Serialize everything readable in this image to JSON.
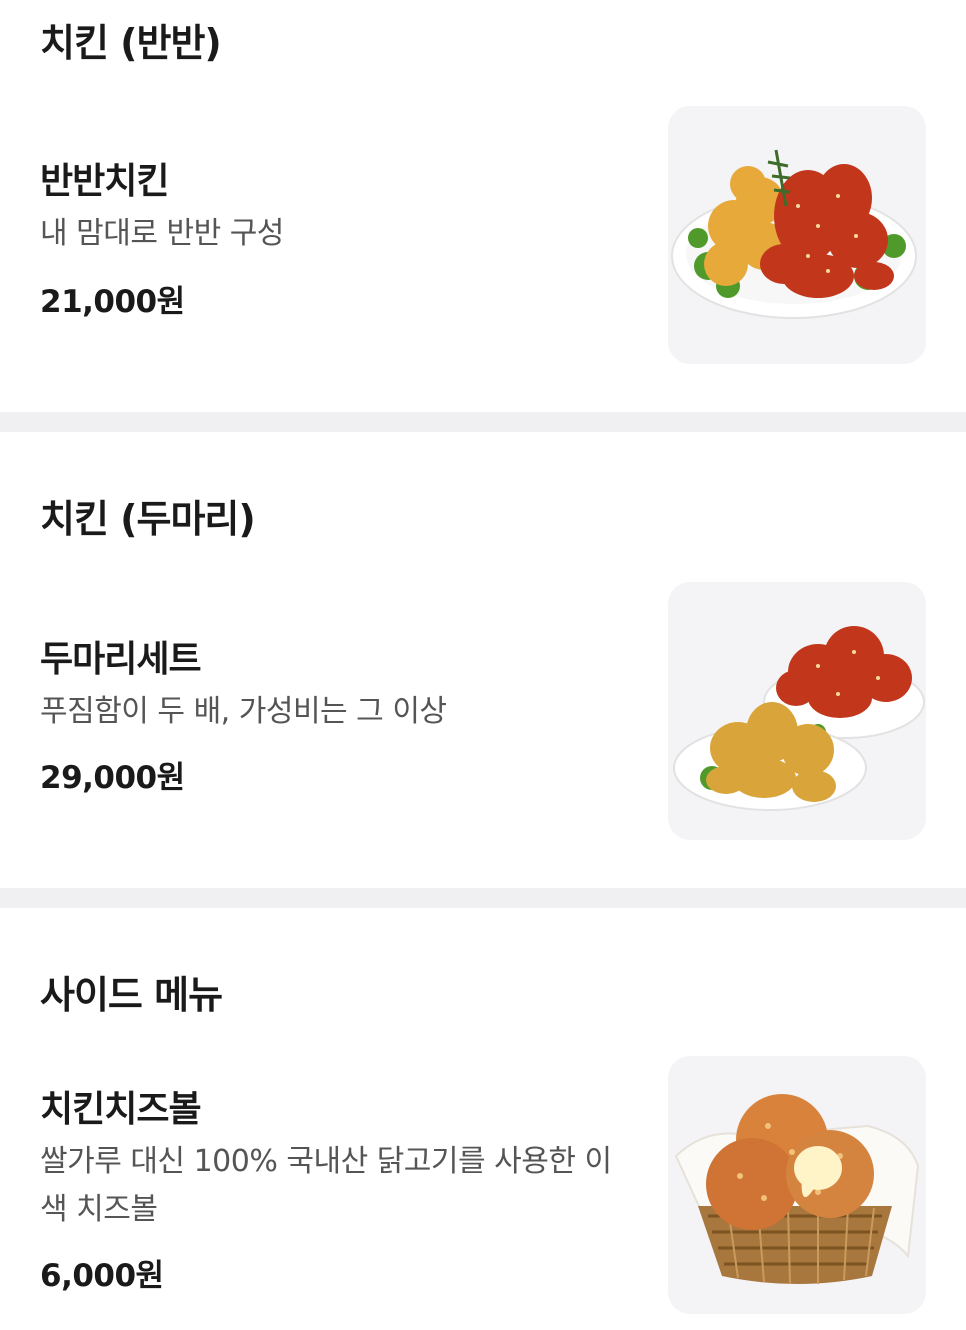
{
  "sections": [
    {
      "title": "치킨 (반반)",
      "items": [
        {
          "name": "반반치킨",
          "description": "내 맘대로 반반 구성",
          "price": "21,000원",
          "image_icon": "half-half-chicken-photo"
        }
      ]
    },
    {
      "title": "치킨 (두마리)",
      "items": [
        {
          "name": "두마리세트",
          "description": "푸짐함이 두 배, 가성비는 그 이상",
          "price": "29,000원",
          "image_icon": "two-chicken-set-photo"
        }
      ]
    },
    {
      "title": "사이드 메뉴",
      "items": [
        {
          "name": "치킨치즈볼",
          "description": "쌀가루 대신 100% 국내산 닭고기를 사용한 이색 치즈볼",
          "price": "6,000원",
          "image_icon": "chicken-cheese-ball-photo"
        }
      ]
    }
  ],
  "colors": {
    "divider": "#f0f0f2",
    "thumb_bg": "#f4f4f6",
    "text_primary": "#1a1a1a",
    "text_secondary": "#555555"
  }
}
